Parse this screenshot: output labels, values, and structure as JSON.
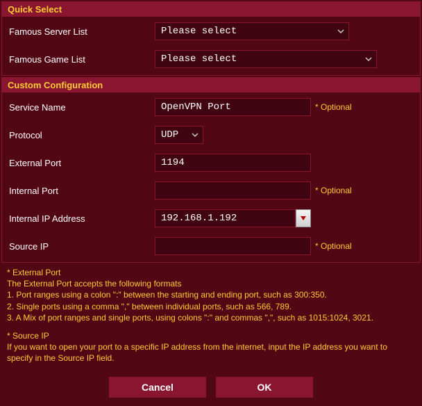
{
  "quick_select": {
    "header": "Quick Select",
    "server_label": "Famous Server List",
    "server_value": "Please select",
    "game_label": "Famous Game List",
    "game_value": "Please select"
  },
  "custom": {
    "header": "Custom Configuration",
    "service_name_label": "Service Name",
    "service_name_value": "OpenVPN Port",
    "protocol_label": "Protocol",
    "protocol_value": "UDP",
    "external_port_label": "External Port",
    "external_port_value": "1194",
    "internal_port_label": "Internal Port",
    "internal_port_value": "",
    "internal_ip_label": "Internal IP Address",
    "internal_ip_value": "192.168.1.192",
    "source_ip_label": "Source IP",
    "source_ip_value": "",
    "optional_text": "* Optional"
  },
  "notes": {
    "ext_title": "* External Port",
    "ext_line0": "The External Port accepts the following formats",
    "ext_line1": "1. Port ranges using a colon \":\" between the starting and ending port, such as 300:350.",
    "ext_line2": "2. Single ports using a comma \",\" between individual ports, such as 566, 789.",
    "ext_line3": "3. A Mix of port ranges and single ports, using colons \":\" and commas \",\", such as 1015:1024, 3021.",
    "src_title": "* Source IP",
    "src_body": "If you want to open your port to a specific IP address from the internet, input the IP address you want to specify in the Source IP field."
  },
  "buttons": {
    "cancel": "Cancel",
    "ok": "OK"
  }
}
